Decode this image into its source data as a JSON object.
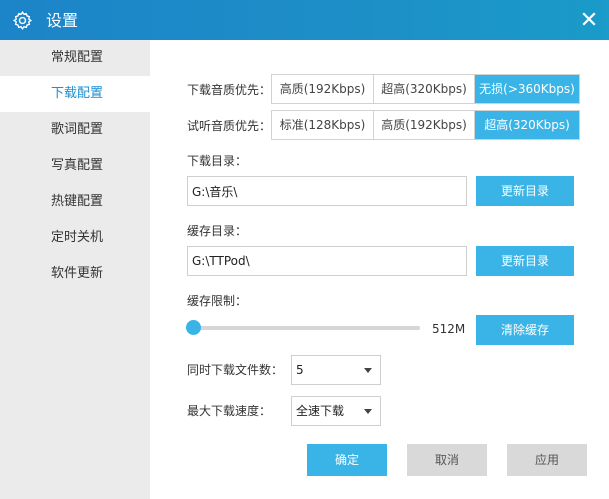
{
  "window": {
    "title": "设置",
    "close_icon": "close-icon",
    "title_icon": "gear-icon"
  },
  "sidebar": {
    "items": [
      {
        "label": "常规配置"
      },
      {
        "label": "下载配置",
        "active": true
      },
      {
        "label": "歌词配置"
      },
      {
        "label": "写真配置"
      },
      {
        "label": "热键配置"
      },
      {
        "label": "定时关机"
      },
      {
        "label": "软件更新"
      }
    ]
  },
  "download_quality": {
    "label": "下载音质优先：",
    "options": [
      "高质(192Kbps)",
      "超高(320Kbps)",
      "无损(>360Kbps)"
    ],
    "selected": "无损(>360Kbps)"
  },
  "preview_quality": {
    "label": "试听音质优先：",
    "options": [
      "标准(128Kbps)",
      "高质(192Kbps)",
      "超高(320Kbps)"
    ],
    "selected": "超高(320Kbps)"
  },
  "download_dir": {
    "label": "下载目录：",
    "value": "G:\\音乐\\",
    "button": "更新目录"
  },
  "cache_dir": {
    "label": "缓存目录：",
    "value": "G:\\TTPod\\",
    "button": "更新目录"
  },
  "cache_limit": {
    "label": "缓存限制：",
    "value": "512M",
    "level": 0,
    "button": "清除缓存"
  },
  "concurrent": {
    "label": "同时下载文件数：",
    "value": "5"
  },
  "max_speed": {
    "label": "最大下载速度：",
    "value": "全速下载"
  },
  "footer": {
    "ok": "确定",
    "cancel": "取消",
    "apply": "应用"
  },
  "colors": {
    "titlebar": "#1d8fc7",
    "accent": "#3ab4e6",
    "sidebar_bg": "#ebebeb",
    "active_text": "#1b8fd1"
  }
}
